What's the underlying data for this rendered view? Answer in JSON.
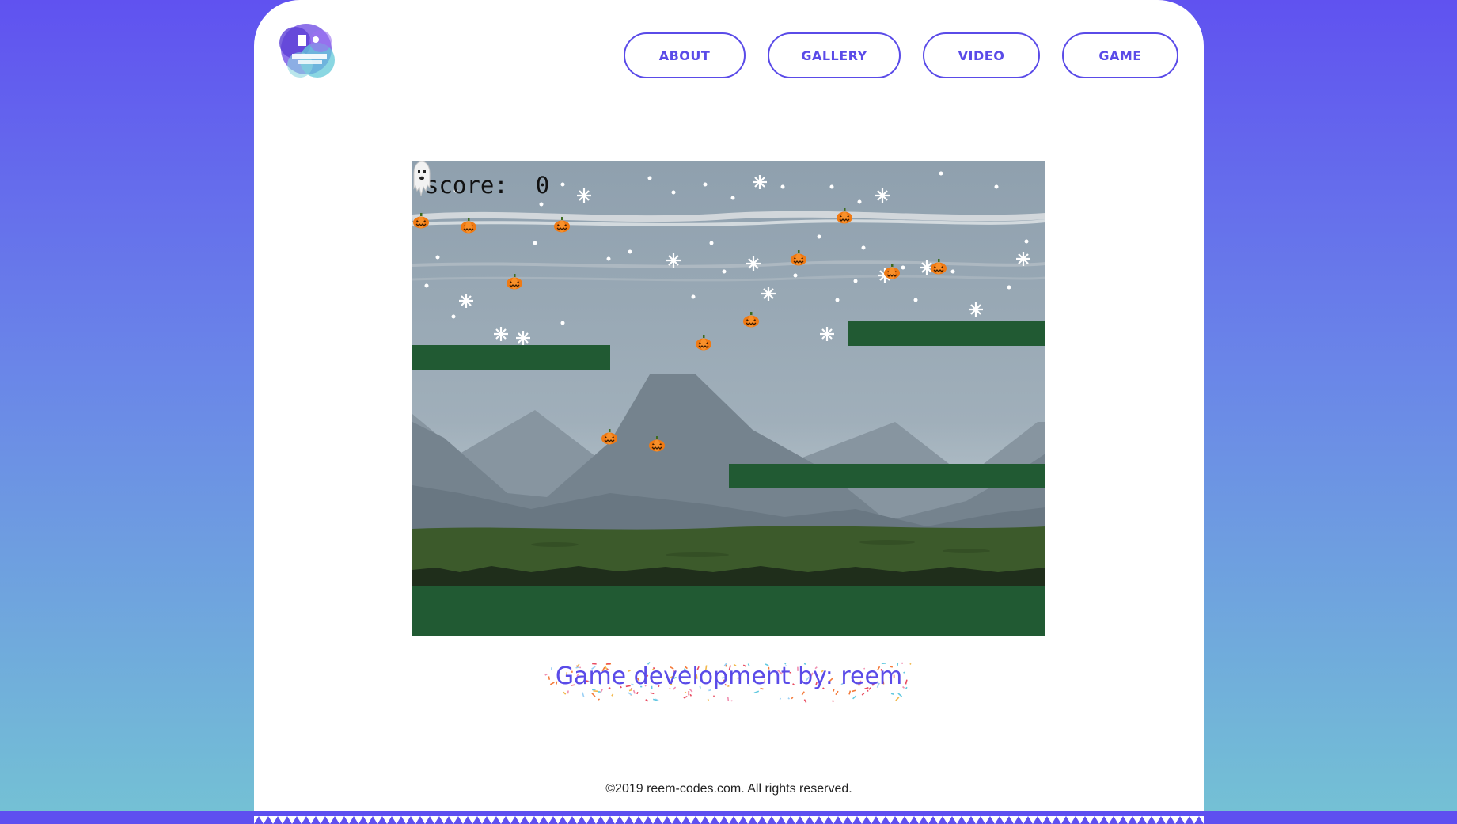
{
  "nav": {
    "about": "ABOUT",
    "gallery": "GALLERY",
    "video": "VIDEO",
    "game": "GAME"
  },
  "game": {
    "score_label": "score:",
    "score_value": "0",
    "player_icon": "ghost-icon",
    "collectible_icon": "pumpkin-icon",
    "colors": {
      "platform": "#215a33",
      "sky": "#8fa0ae",
      "accent": "#5a4be8"
    }
  },
  "credit": "Game development by: reem",
  "footer": {
    "copyright": "©2019 reem-codes.com. All rights reserved."
  }
}
